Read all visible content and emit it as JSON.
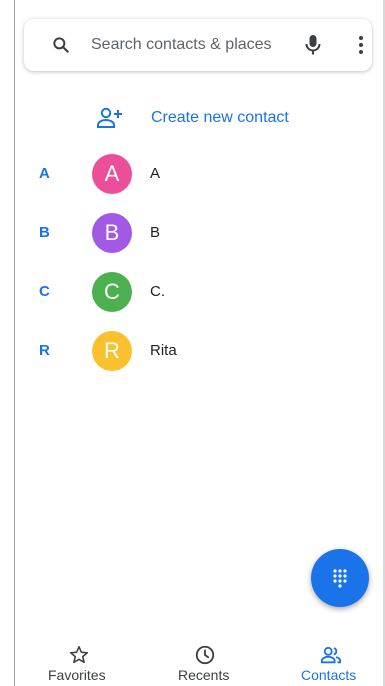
{
  "search": {
    "placeholder": "Search contacts & places",
    "icons": [
      "search-icon",
      "mic-icon",
      "more-vert-icon"
    ]
  },
  "create_contact": {
    "label": "Create new contact",
    "icon": "person-add-icon"
  },
  "contacts": [
    {
      "section": "A",
      "initial": "A",
      "name": "A",
      "color": "#ec4f9a"
    },
    {
      "section": "B",
      "initial": "B",
      "name": "B",
      "color": "#a259e6"
    },
    {
      "section": "C",
      "initial": "C",
      "name": "C.",
      "color": "#4caf50"
    },
    {
      "section": "R",
      "initial": "R",
      "name": "Rita",
      "color": "#f9c12e"
    }
  ],
  "fab": {
    "icon": "dialpad-icon"
  },
  "bottom_nav": [
    {
      "label": "Favorites",
      "icon": "star-icon",
      "active": false
    },
    {
      "label": "Recents",
      "icon": "clock-icon",
      "active": false
    },
    {
      "label": "Contacts",
      "icon": "people-icon",
      "active": true
    }
  ],
  "colors": {
    "accent": "#1a73e8",
    "inactive": "#5f6368"
  }
}
